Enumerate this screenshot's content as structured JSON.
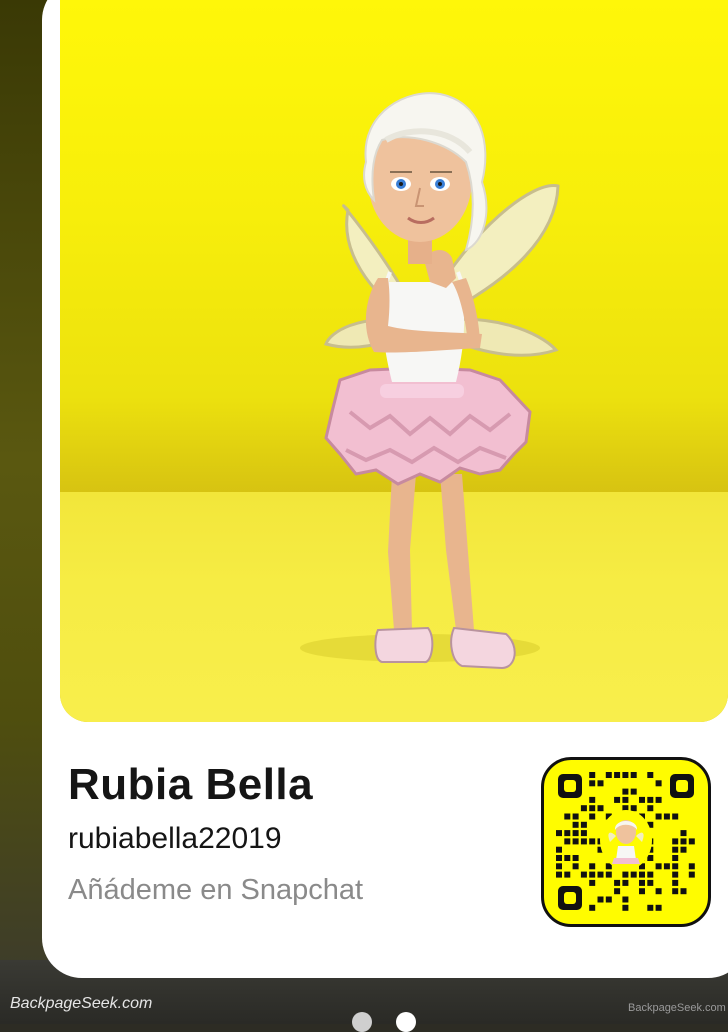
{
  "profile": {
    "display_name": "Rubia Bella",
    "username": "rubiabella22019",
    "add_me_text": "Añádeme en Snapchat"
  },
  "watermark": {
    "left": "BackpageSeek.com",
    "right": "BackpageSeek.com"
  },
  "pager": {
    "pages": 2,
    "active_page": 2
  },
  "colors": {
    "snapchat_yellow": "#fffc00",
    "background_gradient_top": "#fff709",
    "floor": "#f6ec44",
    "name_text": "#151515",
    "secondary_text": "#8a8a8a"
  },
  "icons": {
    "avatar": "bitmoji-fairy-avatar",
    "snapcode": "snapcode-qr-icon"
  }
}
